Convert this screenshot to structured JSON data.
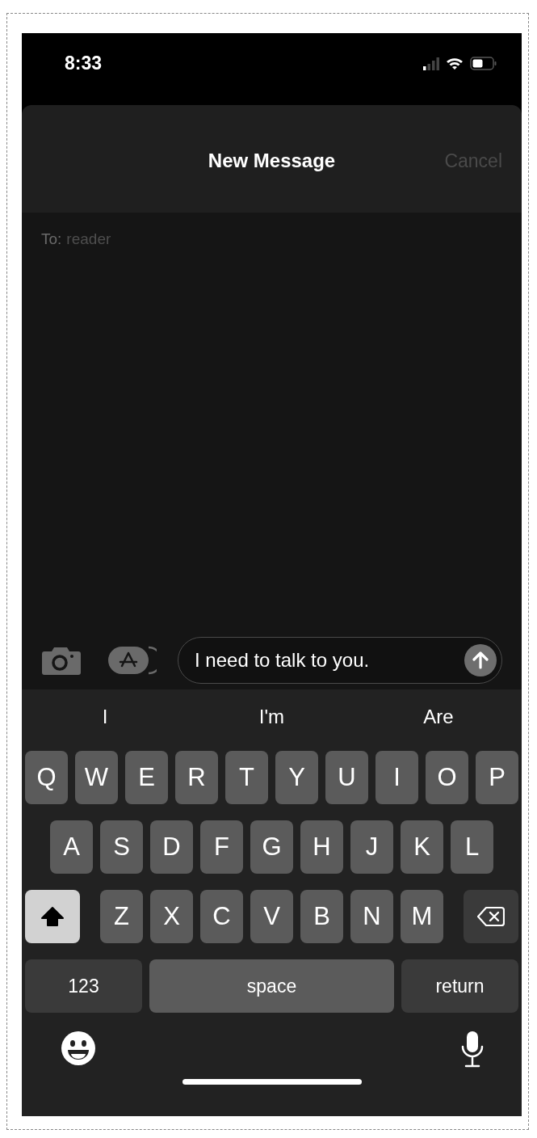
{
  "status_bar": {
    "time": "8:33"
  },
  "header": {
    "title": "New Message",
    "cancel": {
      "label": "Cancel",
      "disabled": true
    }
  },
  "recipient": {
    "label": "To:",
    "value": "reader"
  },
  "compose": {
    "message": "I need to talk to you."
  },
  "suggestions": [
    "I",
    "I'm",
    "Are"
  ],
  "keyboard": {
    "letter_rows": [
      [
        "Q",
        "W",
        "E",
        "R",
        "T",
        "Y",
        "U",
        "I",
        "O",
        "P"
      ],
      [
        "A",
        "S",
        "D",
        "F",
        "G",
        "H",
        "J",
        "K",
        "L"
      ],
      [
        "Z",
        "X",
        "C",
        "V",
        "B",
        "N",
        "M"
      ]
    ],
    "shift_on": true,
    "bottom_keys": [
      {
        "label": "123",
        "kind": "mode"
      },
      {
        "label": "space",
        "kind": "space"
      },
      {
        "label": "return",
        "kind": "return"
      }
    ]
  }
}
